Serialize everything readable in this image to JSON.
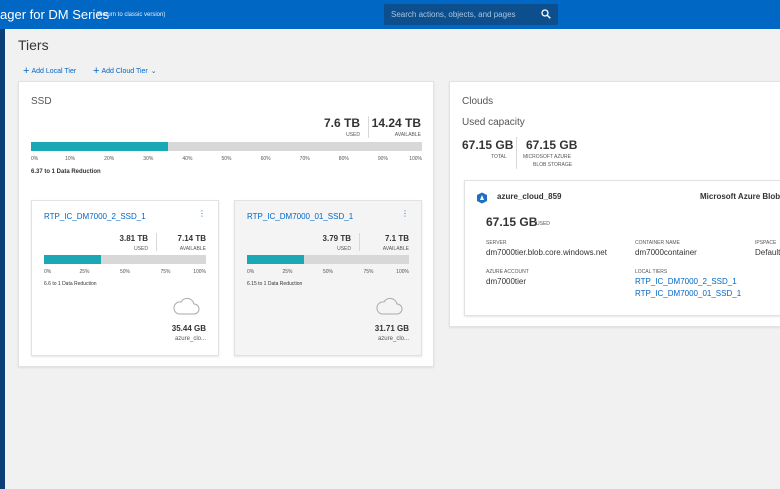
{
  "header": {
    "brand": "ager for DM Series",
    "classic_link": "(Return to classic version)",
    "search_placeholder": "Search actions, objects, and pages"
  },
  "page": {
    "title": "Tiers",
    "add_local": "Add Local Tier",
    "add_cloud": "Add Cloud Tier"
  },
  "ssd": {
    "title": "SSD",
    "used_value": "7.6 TB",
    "used_label": "USED",
    "available_value": "14.24 TB",
    "available_label": "AVAILABLE",
    "progress": 0.35,
    "ticks": [
      "0%",
      "10%",
      "20%",
      "30%",
      "40%",
      "50%",
      "60%",
      "70%",
      "80%",
      "90%",
      "100%"
    ],
    "reduction": "6.37 to 1 Data Reduction",
    "tiers": [
      {
        "name": "RTP_IC_DM7000_2_SSD_1",
        "used_value": "3.81 TB",
        "used_label": "USED",
        "available_value": "7.14 TB",
        "available_label": "AVAILABLE",
        "progress": 0.35,
        "ticks": [
          "0%",
          "25%",
          "50%",
          "75%",
          "100%"
        ],
        "reduction": "6.6 to 1 Data Reduction",
        "cloud_capacity": "35.44 GB",
        "cloud_name": "azure_clo..."
      },
      {
        "name": "RTP_IC_DM7000_01_SSD_1",
        "used_value": "3.79 TB",
        "used_label": "USED",
        "available_value": "7.1 TB",
        "available_label": "AVAILABLE",
        "progress": 0.35,
        "ticks": [
          "0%",
          "25%",
          "50%",
          "75%",
          "100%"
        ],
        "reduction": "6.15 to 1 Data Reduction",
        "cloud_capacity": "31.71 GB",
        "cloud_name": "azure_clo..."
      }
    ]
  },
  "clouds": {
    "title": "Clouds",
    "subtitle": "Used capacity",
    "total_value": "67.15 GB",
    "total_label": "TOTAL",
    "azure_value": "67.15 GB",
    "azure_label_1": "MICROSOFT AZURE",
    "azure_label_2": "BLOB STORAGE",
    "card": {
      "name": "azure_cloud_859",
      "provider": "Microsoft Azure Blob Storag",
      "used_value": "67.15 GB",
      "used_label": "USED",
      "server_label": "SERVER",
      "server_value": "dm7000tier.blob.core.windows.net",
      "container_label": "CONTAINER NAME",
      "container_value": "dm7000container",
      "ipspace_label": "IPSPACE",
      "ipspace_value": "Default",
      "account_label": "AZURE ACCOUNT",
      "account_value": "dm7000tier",
      "local_tiers_label": "LOCAL TIERS",
      "local_tiers": [
        "RTP_IC_DM7000_2_SSD_1",
        "RTP_IC_DM7000_01_SSD_1"
      ]
    }
  }
}
